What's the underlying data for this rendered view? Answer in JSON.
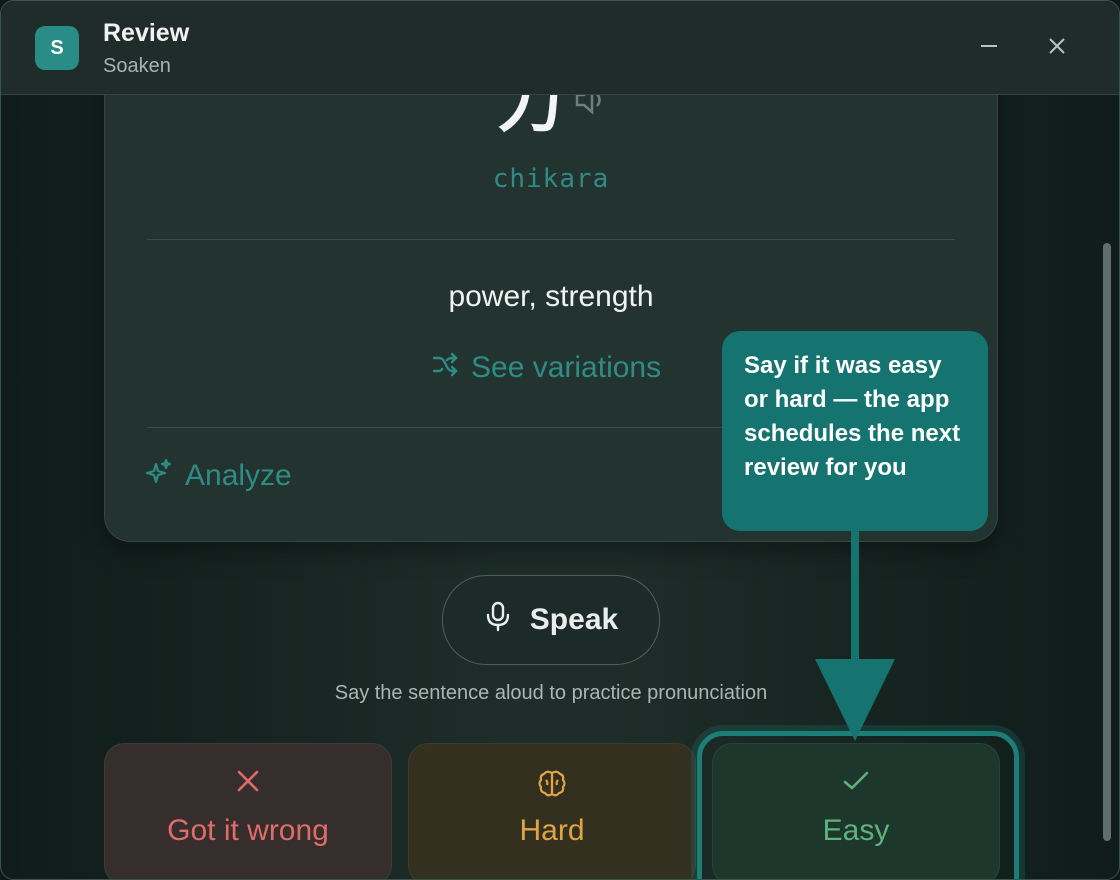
{
  "window": {
    "app_icon_letter": "S",
    "title": "Review",
    "subtitle": "Soaken"
  },
  "card": {
    "kanji": "力",
    "reading": "chikara",
    "meaning": "power, strength",
    "variations_label": "See variations",
    "analyze_label": "Analyze"
  },
  "speak": {
    "button_label": "Speak",
    "hint": "Say the sentence aloud to practice pronunciation"
  },
  "rating": {
    "wrong_label": "Got it wrong",
    "hard_label": "Hard",
    "easy_label": "Easy"
  },
  "tooltip": {
    "text": "Say if it was easy or hard — the app schedules the next review for you"
  },
  "colors": {
    "accent": "#2a8c86",
    "tooltip": "#157470",
    "wrong": "#e06c68",
    "hard": "#e0a443",
    "easy": "#5fb27b"
  },
  "icons": {
    "app": "app-logo-icon",
    "minimize": "minimize-icon",
    "close": "close-icon",
    "speaker": "speaker-icon",
    "shuffle": "shuffle-icon",
    "sparkles": "sparkles-icon",
    "mic": "microphone-icon",
    "x": "x-icon",
    "brain": "brain-icon",
    "check": "check-icon"
  }
}
